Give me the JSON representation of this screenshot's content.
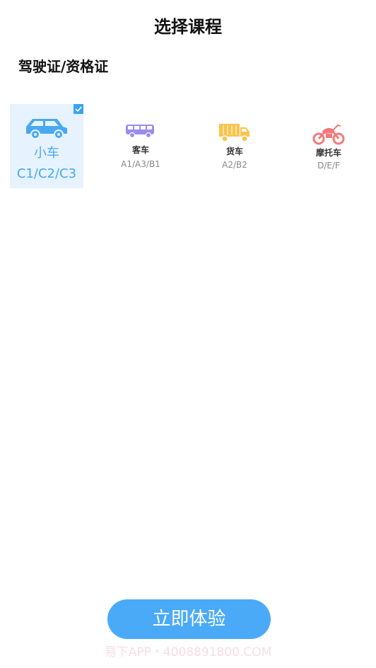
{
  "header": {
    "title": "选择课程"
  },
  "section": {
    "title": "驾驶证/资格证"
  },
  "vehicles": [
    {
      "name": "小车",
      "code": "C1/C2/C3",
      "selected": true,
      "icon": "car-icon",
      "color": "#4aa8f0"
    },
    {
      "name": "客车",
      "code": "A1/A3/B1",
      "selected": false,
      "icon": "bus-icon",
      "color": "#9b8cf0"
    },
    {
      "name": "货车",
      "code": "A2/B2",
      "selected": false,
      "icon": "truck-icon",
      "color": "#f8c44a"
    },
    {
      "name": "摩托车",
      "code": "D/E/F",
      "selected": false,
      "icon": "motorcycle-icon",
      "color": "#f47a7a"
    }
  ],
  "footer": {
    "button_label": "立即体验",
    "watermark": "易下APP・4008891800.COM"
  },
  "colors": {
    "accent": "#4aaaf8",
    "selected_bg": "#e6f3ff"
  }
}
